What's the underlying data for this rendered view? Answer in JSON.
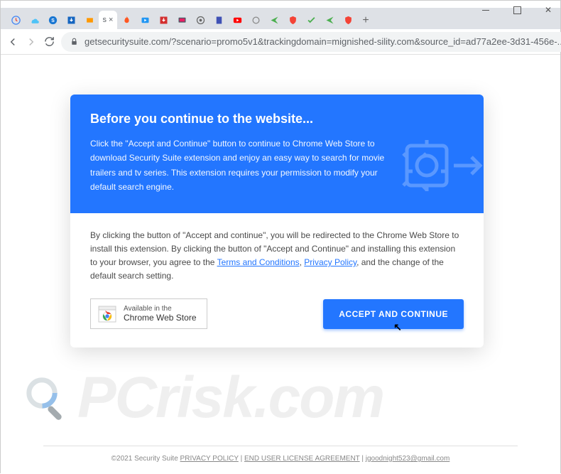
{
  "window": {
    "min": "minimize",
    "max": "maximize",
    "close": "close"
  },
  "tabs": {
    "active_close": "s ×",
    "newtab": "+"
  },
  "toolbar": {
    "url": "getsecuritysuite.com/?scenario=promo5v1&trackingdomain=mignished-sility.com&source_id=ad77a2ee-3d31-456e-..."
  },
  "modal": {
    "title": "Before you continue to the website...",
    "intro": "Click the \"Accept and Continue\" button to continue to Chrome Web Store to download Security Suite extension and enjoy an easy way to search for movie trailers and tv series. This extension requires your permission to modify your default search engine.",
    "body_pre": "By clicking the button of \"Accept and continue\", you will be redirected to the Chrome Web Store to install this extension. By clicking the button of \"Accept and Continue\" and installing this extension to your browser, you agree to the ",
    "terms": "Terms and Conditions",
    "sep1": ", ",
    "privacy": "Privacy Policy",
    "body_post": ", and the change of the default search setting.",
    "cws_avail": "Available in the",
    "cws_store": "Chrome Web Store",
    "accept": "ACCEPT AND CONTINUE"
  },
  "footer": {
    "copyright": "©2021 Security Suite ",
    "privacy": "PRIVACY POLICY",
    "sep": " | ",
    "eula": "END USER LICENSE AGREEMENT",
    "sep2": " | ",
    "email": "jgoodnight523@gmail.com"
  },
  "watermark": {
    "text": "PCrisk.com"
  }
}
